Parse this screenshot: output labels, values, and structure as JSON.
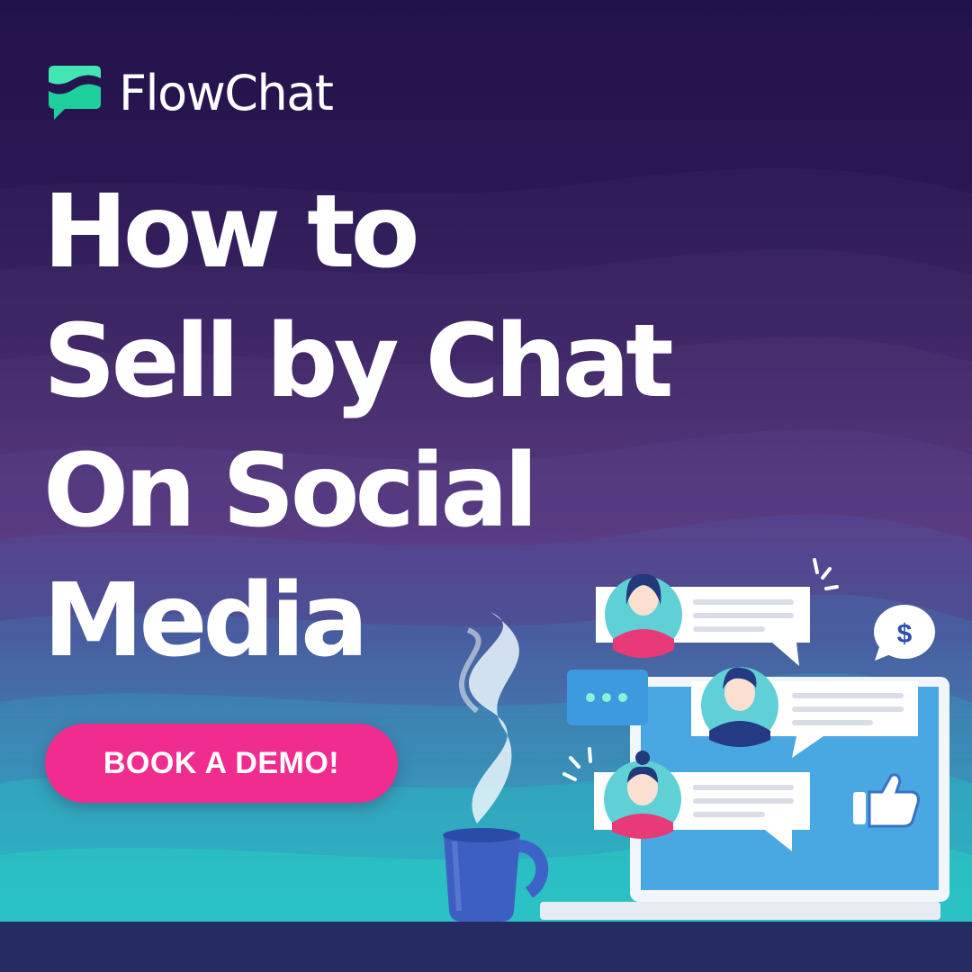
{
  "brand": {
    "name": "FlowChat"
  },
  "headline": {
    "lines": [
      "How to",
      "Sell by Chat",
      "On Social",
      "Media"
    ]
  },
  "cta": {
    "label": "BOOK A DEMO!"
  },
  "illustration": {
    "dollar_symbol": "$"
  },
  "colors": {
    "background_top": "#22124a",
    "background_bottom": "#1fe1c6",
    "logo_teal": "#2ee0b0",
    "cta_pink": "#f02d8e",
    "footer": "#252b63"
  }
}
